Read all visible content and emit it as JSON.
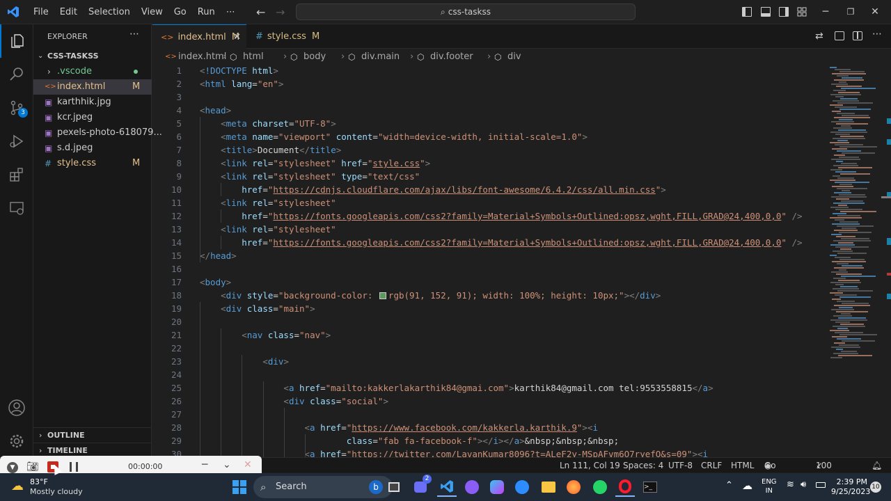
{
  "menu": [
    "File",
    "Edit",
    "Selection",
    "View",
    "Go",
    "Run",
    "⋯"
  ],
  "command_center": "css-taskss",
  "sidebar": {
    "title": "EXPLORER",
    "project": "CSS-TASKSS",
    "items": [
      {
        "label": ".vscode",
        "status": "",
        "kind": "folder"
      },
      {
        "label": "index.html",
        "status": "M",
        "kind": "html"
      },
      {
        "label": "karthhik.jpg",
        "status": "",
        "kind": "image"
      },
      {
        "label": "kcr.jpeg",
        "status": "",
        "kind": "image"
      },
      {
        "label": "pexels-photo-618079...",
        "status": "",
        "kind": "image"
      },
      {
        "label": "s.d.jpeg",
        "status": "",
        "kind": "image"
      },
      {
        "label": "style.css",
        "status": "M",
        "kind": "css"
      }
    ],
    "outline": "OUTLINE",
    "timeline": "TIMELINE",
    "source_control_badge": "3"
  },
  "tabs": [
    {
      "label": "index.html",
      "status": "M"
    },
    {
      "label": "style.css",
      "status": "M"
    }
  ],
  "breadcrumb": [
    "index.html",
    "html",
    "body",
    "div.main",
    "div.footer",
    "div"
  ],
  "code_lines": [
    {
      "n": "1",
      "tokens": [
        [
          "t",
          "<"
        ],
        [
          "tg",
          "!DOCTYPE "
        ],
        [
          "at",
          "html"
        ],
        [
          "t",
          ">"
        ]
      ]
    },
    {
      "n": "2",
      "tokens": [
        [
          "t",
          "<"
        ],
        [
          "tg",
          "html "
        ],
        [
          "at",
          "lang"
        ],
        [
          "tx",
          "="
        ],
        [
          "st",
          "\"en\""
        ],
        [
          "t",
          ">"
        ]
      ]
    },
    {
      "n": "3",
      "tokens": []
    },
    {
      "n": "4",
      "tokens": [
        [
          "t",
          "<"
        ],
        [
          "tg",
          "head"
        ],
        [
          "t",
          ">"
        ]
      ]
    },
    {
      "n": "5",
      "tokens": [
        [
          "tx",
          "    "
        ],
        [
          "t",
          "<"
        ],
        [
          "tg",
          "meta "
        ],
        [
          "at",
          "charset"
        ],
        [
          "tx",
          "="
        ],
        [
          "st",
          "\"UTF-8\""
        ],
        [
          "t",
          ">"
        ]
      ]
    },
    {
      "n": "6",
      "tokens": [
        [
          "tx",
          "    "
        ],
        [
          "t",
          "<"
        ],
        [
          "tg",
          "meta "
        ],
        [
          "at",
          "name"
        ],
        [
          "tx",
          "="
        ],
        [
          "st",
          "\"viewport\" "
        ],
        [
          "at",
          "content"
        ],
        [
          "tx",
          "="
        ],
        [
          "st",
          "\"width=device-width, initial-scale=1.0\""
        ],
        [
          "t",
          ">"
        ]
      ]
    },
    {
      "n": "7",
      "tokens": [
        [
          "tx",
          "    "
        ],
        [
          "t",
          "<"
        ],
        [
          "tg",
          "title"
        ],
        [
          "t",
          ">"
        ],
        [
          "tx",
          "Document"
        ],
        [
          "t",
          "</"
        ],
        [
          "tg",
          "title"
        ],
        [
          "t",
          ">"
        ]
      ]
    },
    {
      "n": "8",
      "tokens": [
        [
          "tx",
          "    "
        ],
        [
          "t",
          "<"
        ],
        [
          "tg",
          "link "
        ],
        [
          "at",
          "rel"
        ],
        [
          "tx",
          "="
        ],
        [
          "st",
          "\"stylesheet\" "
        ],
        [
          "at",
          "href"
        ],
        [
          "tx",
          "="
        ],
        [
          "st",
          "\""
        ],
        [
          "stu",
          "style.css"
        ],
        [
          "st",
          "\""
        ],
        [
          "t",
          ">"
        ]
      ]
    },
    {
      "n": "9",
      "tokens": [
        [
          "tx",
          "    "
        ],
        [
          "t",
          "<"
        ],
        [
          "tg",
          "link "
        ],
        [
          "at",
          "rel"
        ],
        [
          "tx",
          "="
        ],
        [
          "st",
          "\"stylesheet\" "
        ],
        [
          "at",
          "type"
        ],
        [
          "tx",
          "="
        ],
        [
          "st",
          "\"text/css\""
        ]
      ]
    },
    {
      "n": "10",
      "tokens": [
        [
          "tx",
          "        "
        ],
        [
          "at",
          "href"
        ],
        [
          "tx",
          "="
        ],
        [
          "st",
          "\""
        ],
        [
          "stu",
          "https://cdnjs.cloudflare.com/ajax/libs/font-awesome/6.4.2/css/all.min.css"
        ],
        [
          "st",
          "\""
        ],
        [
          "t",
          ">"
        ]
      ]
    },
    {
      "n": "11",
      "tokens": [
        [
          "tx",
          "    "
        ],
        [
          "t",
          "<"
        ],
        [
          "tg",
          "link "
        ],
        [
          "at",
          "rel"
        ],
        [
          "tx",
          "="
        ],
        [
          "st",
          "\"stylesheet\""
        ]
      ]
    },
    {
      "n": "12",
      "tokens": [
        [
          "tx",
          "        "
        ],
        [
          "at",
          "href"
        ],
        [
          "tx",
          "="
        ],
        [
          "st",
          "\""
        ],
        [
          "stu",
          "https://fonts.googleapis.com/css2?family=Material+Symbols+Outlined:opsz,wght,FILL,GRAD@24,400,0,0"
        ],
        [
          "st",
          "\""
        ],
        [
          "t",
          " />"
        ]
      ]
    },
    {
      "n": "13",
      "tokens": [
        [
          "tx",
          "    "
        ],
        [
          "t",
          "<"
        ],
        [
          "tg",
          "link "
        ],
        [
          "at",
          "rel"
        ],
        [
          "tx",
          "="
        ],
        [
          "st",
          "\"stylesheet\""
        ]
      ]
    },
    {
      "n": "14",
      "tokens": [
        [
          "tx",
          "        "
        ],
        [
          "at",
          "href"
        ],
        [
          "tx",
          "="
        ],
        [
          "st",
          "\""
        ],
        [
          "stu",
          "https://fonts.googleapis.com/css2?family=Material+Symbols+Outlined:opsz,wght,FILL,GRAD@24,400,0,0"
        ],
        [
          "st",
          "\""
        ],
        [
          "t",
          " />"
        ]
      ]
    },
    {
      "n": "15",
      "tokens": [
        [
          "t",
          "</"
        ],
        [
          "tg",
          "head"
        ],
        [
          "t",
          ">"
        ]
      ]
    },
    {
      "n": "16",
      "tokens": []
    },
    {
      "n": "17",
      "tokens": [
        [
          "t",
          "<"
        ],
        [
          "tg",
          "body"
        ],
        [
          "t",
          ">"
        ]
      ]
    },
    {
      "n": "18",
      "tokens": [
        [
          "tx",
          "    "
        ],
        [
          "t",
          "<"
        ],
        [
          "tg",
          "div "
        ],
        [
          "at",
          "style"
        ],
        [
          "tx",
          "="
        ],
        [
          "st",
          "\"background-color: "
        ],
        [
          "sw",
          ""
        ],
        [
          "st",
          "rgb(91, 152, 91); width: 100%; height: 10px;\""
        ],
        [
          "t",
          "></"
        ],
        [
          "tg",
          "div"
        ],
        [
          "t",
          ">"
        ]
      ]
    },
    {
      "n": "19",
      "tokens": [
        [
          "tx",
          "    "
        ],
        [
          "t",
          "<"
        ],
        [
          "tg",
          "div "
        ],
        [
          "at",
          "class"
        ],
        [
          "tx",
          "="
        ],
        [
          "st",
          "\"main\""
        ],
        [
          "t",
          ">"
        ]
      ]
    },
    {
      "n": "20",
      "tokens": []
    },
    {
      "n": "21",
      "tokens": [
        [
          "tx",
          "        "
        ],
        [
          "t",
          "<"
        ],
        [
          "tg",
          "nav "
        ],
        [
          "at",
          "class"
        ],
        [
          "tx",
          "="
        ],
        [
          "st",
          "\"nav\""
        ],
        [
          "t",
          ">"
        ]
      ]
    },
    {
      "n": "22",
      "tokens": []
    },
    {
      "n": "23",
      "tokens": [
        [
          "tx",
          "            "
        ],
        [
          "t",
          "<"
        ],
        [
          "tg",
          "div"
        ],
        [
          "t",
          ">"
        ]
      ]
    },
    {
      "n": "24",
      "tokens": []
    },
    {
      "n": "25",
      "tokens": [
        [
          "tx",
          "                "
        ],
        [
          "t",
          "<"
        ],
        [
          "tg",
          "a "
        ],
        [
          "at",
          "href"
        ],
        [
          "tx",
          "="
        ],
        [
          "st",
          "\"mailto:kakkerlakarthik84@gmai.com\""
        ],
        [
          "t",
          ">"
        ],
        [
          "tx",
          "karthik84@gmail.com tel:9553558815"
        ],
        [
          "t",
          "</"
        ],
        [
          "tg",
          "a"
        ],
        [
          "t",
          ">"
        ]
      ]
    },
    {
      "n": "26",
      "tokens": [
        [
          "tx",
          "                "
        ],
        [
          "t",
          "<"
        ],
        [
          "tg",
          "div "
        ],
        [
          "at",
          "class"
        ],
        [
          "tx",
          "="
        ],
        [
          "st",
          "\"social\""
        ],
        [
          "t",
          ">"
        ]
      ]
    },
    {
      "n": "27",
      "tokens": []
    },
    {
      "n": "28",
      "tokens": [
        [
          "tx",
          "                    "
        ],
        [
          "t",
          "<"
        ],
        [
          "tg",
          "a "
        ],
        [
          "at",
          "href"
        ],
        [
          "tx",
          "="
        ],
        [
          "st",
          "\""
        ],
        [
          "stu",
          "https://www.facebook.com/kakkerla.karthik.9"
        ],
        [
          "st",
          "\""
        ],
        [
          "t",
          "><"
        ],
        [
          "tg",
          "i"
        ]
      ]
    },
    {
      "n": "29",
      "tokens": [
        [
          "tx",
          "                            "
        ],
        [
          "at",
          "class"
        ],
        [
          "tx",
          "="
        ],
        [
          "st",
          "\"fab fa-facebook-f\""
        ],
        [
          "t",
          "></"
        ],
        [
          "tg",
          "i"
        ],
        [
          "t",
          "></"
        ],
        [
          "tg",
          "a"
        ],
        [
          "t",
          ">"
        ],
        [
          "tx",
          "&nbsp;&nbsp;&nbsp;"
        ]
      ]
    },
    {
      "n": "30",
      "tokens": [
        [
          "tx",
          "                    "
        ],
        [
          "t",
          "<"
        ],
        [
          "tg",
          "a "
        ],
        [
          "at",
          "href"
        ],
        [
          "tx",
          "="
        ],
        [
          "st",
          "\""
        ],
        [
          "stu",
          "https://twitter.com/LavanKumar8096?t=ALeF2y-MSpAFvm6O7ryefQ&s=09"
        ],
        [
          "st",
          "\""
        ],
        [
          "t",
          "><"
        ],
        [
          "tg",
          "i"
        ]
      ]
    }
  ],
  "swatch_color": "#5b985b",
  "status": {
    "position": "Ln 111, Col 19",
    "spaces": "Spaces: 4",
    "encoding": "UTF-8",
    "eol": "CRLF",
    "language": "HTML",
    "go_live": "Go Live",
    "spell": "100 Spell"
  },
  "recorder": {
    "timer": "00:00:00"
  },
  "taskbar": {
    "temp": "83°F",
    "weather": "Mostly cloudy",
    "search": "Search",
    "lang": "ENG",
    "region": "IN",
    "time": "2:39 PM",
    "date": "9/25/2023",
    "notif": "10",
    "chat_badge": "2"
  }
}
